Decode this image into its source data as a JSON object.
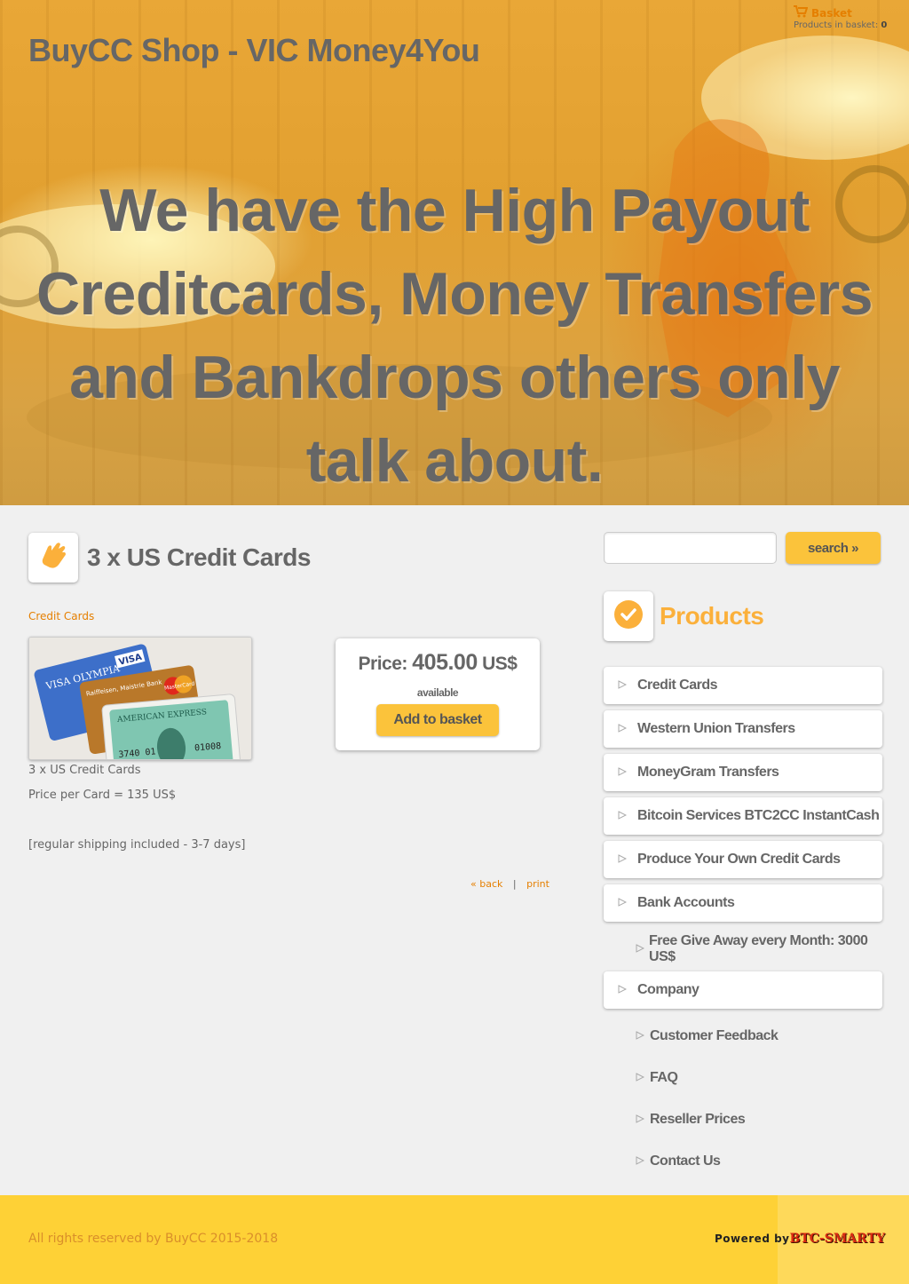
{
  "header": {
    "site_title": "BuyCC Shop - VIC Money4You",
    "hero_text": "We have the High Payout Creditcards, Money Transfers and Bankdrops others only talk about.",
    "basket": {
      "label": "Basket",
      "count_label": "Products in basket:",
      "count": "0"
    }
  },
  "main": {
    "page_icon": "hand-icon",
    "page_title": "3 x US Credit Cards",
    "category_link": "Credit Cards",
    "price": {
      "label": "Price:",
      "value": "405.00",
      "currency": "US$",
      "availability": "available",
      "add_to_basket_label": "Add to basket"
    },
    "description": {
      "name": "3 x US Credit Cards",
      "price_per_card": "Price per Card = 135 US$",
      "shipping": "[regular shipping included - 3-7 days]"
    },
    "links": {
      "back": "« back",
      "separator": "|",
      "print": "print"
    }
  },
  "sidebar": {
    "search": {
      "placeholder": "",
      "button_label": "search »"
    },
    "products_title": "Products",
    "products_icon": "checkmark-icon",
    "nav": [
      "Credit Cards",
      "Western Union Transfers",
      "MoneyGram Transfers",
      "Bitcoin Services BTC2CC InstantCash",
      "Produce Your Own Credit Cards",
      "Bank Accounts"
    ],
    "bank_sub": [
      "Free Give Away every Month: 3000 US$"
    ],
    "company": "Company",
    "company_sub": [
      "Customer Feedback",
      "FAQ",
      "Reseller Prices",
      "Contact Us"
    ]
  },
  "footer": {
    "copyright": "All rights reserved by BuyCC 2015-2018",
    "powered_prefix": "Powered by",
    "powered_brand": "BTC-SMARTY"
  },
  "colors": {
    "accent_orange": "#e57f00",
    "button_yellow": "#fbc33b",
    "footer_yellow": "#fed136",
    "products_title": "#fbb03b",
    "text_gray": "#666666"
  }
}
